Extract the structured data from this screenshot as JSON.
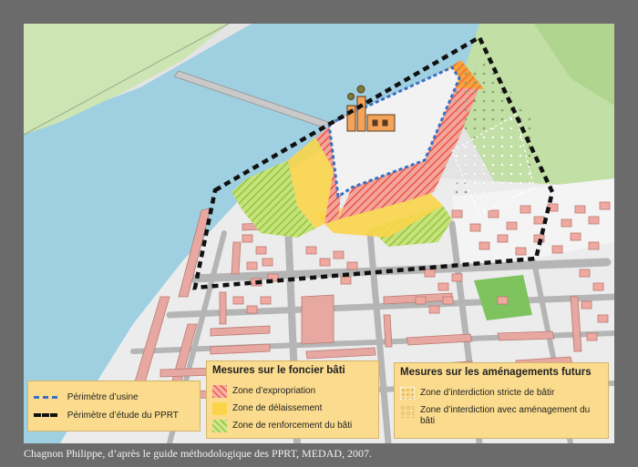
{
  "caption": "Chagnon Philippe, d’après le guide méthodologique des PPRT, MEDAD, 2007.",
  "legend_perimeters": {
    "items": [
      {
        "label": "Périmètre d’usine",
        "color": "#3a6fc4",
        "style": "dashed-blue"
      },
      {
        "label": "Périmètre d’étude du PPRT",
        "color": "#111111",
        "style": "dashed-black"
      }
    ]
  },
  "legend_foncier": {
    "title": "Mesures sur le foncier bâti",
    "items": [
      {
        "label": "Zone d’expropriation",
        "color": "#ee6b5a"
      },
      {
        "label": "Zone de délaissement",
        "color": "#fad54a"
      },
      {
        "label": "Zone de renforcement du bâti",
        "color": "#9fcc3c"
      }
    ]
  },
  "legend_amenagements": {
    "title": "Mesures sur les aménagements futurs",
    "items": [
      {
        "label": "Zone d’interdiction stricte de bâtir"
      },
      {
        "label": "Zone d’interdiction avec aménagement du bâti"
      }
    ]
  },
  "colors": {
    "water": "#9fd0e2",
    "riverbank": "#cde5b2",
    "field": "#b6d69a",
    "park": "#86c765",
    "road": "#b3b3b3",
    "building_roof": "#e7a8a2",
    "factory": "#f3a35a"
  }
}
